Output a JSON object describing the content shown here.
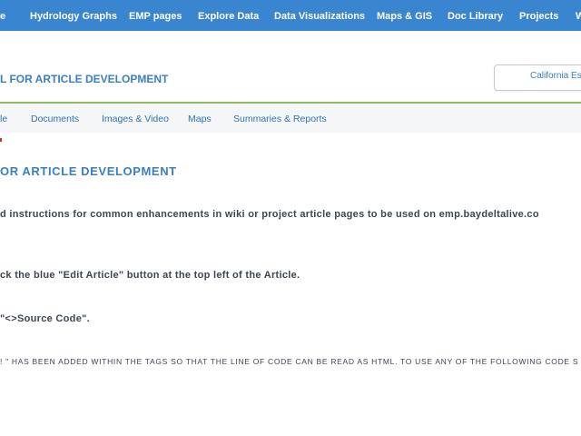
{
  "topnav": {
    "items": [
      "e",
      "Hydrology Graphs",
      "EMP pages",
      "Explore Data",
      "Data Visualizations",
      "Maps & GIS",
      "Doc Library",
      "Projects",
      "W"
    ]
  },
  "header": {
    "title": "L FOR ARTICLE DEVELOPMENT",
    "site_button": "California Es"
  },
  "subnav": {
    "items": [
      "le",
      "Documents",
      "Images & Video",
      "Maps",
      "Summaries & Reports"
    ]
  },
  "main": {
    "title": "OR ARTICLE DEVELOPMENT",
    "p1": "d instructions for common enhancements in wiki or project article pages to be used on emp.baydeltalive.co",
    "p2": "ck the blue \"Edit Article\" button at the top left of the Article.",
    "p3": "\"<>Source Code\".",
    "p4": "! \" HAS BEEN ADDED WITHIN THE TAGS SO THAT THE LINE OF CODE CAN BE READ AS HTML. TO USE ANY OF THE FOLLOWING CODE S"
  },
  "colors": {
    "nav_bg": "#3a85d0",
    "accent_blue": "#3a7fc3",
    "rule_green": "#8dbf58",
    "subnav_bg": "#f4f6f7",
    "body_text": "#3d4650"
  }
}
